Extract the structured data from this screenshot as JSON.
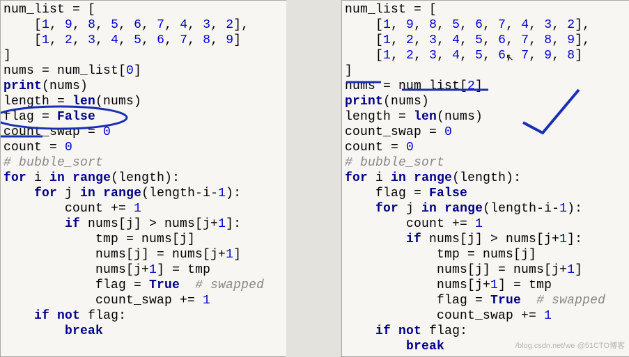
{
  "left": {
    "lines": [
      [
        [
          "num_list ",
          "id"
        ],
        [
          "= [",
          "id"
        ]
      ],
      [
        [
          "    [",
          "id"
        ],
        [
          "1",
          "num"
        ],
        [
          ", ",
          "id"
        ],
        [
          "9",
          "num"
        ],
        [
          ", ",
          "id"
        ],
        [
          "8",
          "num"
        ],
        [
          ", ",
          "id"
        ],
        [
          "5",
          "num"
        ],
        [
          ", ",
          "id"
        ],
        [
          "6",
          "num"
        ],
        [
          ", ",
          "id"
        ],
        [
          "7",
          "num"
        ],
        [
          ", ",
          "id"
        ],
        [
          "4",
          "num"
        ],
        [
          ", ",
          "id"
        ],
        [
          "3",
          "num"
        ],
        [
          ", ",
          "id"
        ],
        [
          "2",
          "num"
        ],
        [
          "],",
          "id"
        ]
      ],
      [
        [
          "    [",
          "id"
        ],
        [
          "1",
          "num"
        ],
        [
          ", ",
          "id"
        ],
        [
          "2",
          "num"
        ],
        [
          ", ",
          "id"
        ],
        [
          "3",
          "num"
        ],
        [
          ", ",
          "id"
        ],
        [
          "4",
          "num"
        ],
        [
          ", ",
          "id"
        ],
        [
          "5",
          "num"
        ],
        [
          ", ",
          "id"
        ],
        [
          "6",
          "num"
        ],
        [
          ", ",
          "id"
        ],
        [
          "7",
          "num"
        ],
        [
          ", ",
          "id"
        ],
        [
          "8",
          "num"
        ],
        [
          ", ",
          "id"
        ],
        [
          "9",
          "num"
        ],
        [
          "]",
          "id"
        ]
      ],
      [
        [
          "]",
          "id"
        ]
      ],
      [
        [
          "nums = num_list[",
          "id"
        ],
        [
          "0",
          "num"
        ],
        [
          "]",
          "id"
        ]
      ],
      [
        [
          "print",
          "kw"
        ],
        [
          "(nums)",
          "id"
        ]
      ],
      [
        [
          "length = ",
          "id"
        ],
        [
          "len",
          "kw"
        ],
        [
          "(nums)",
          "id"
        ]
      ],
      [
        [
          "flag = ",
          "id"
        ],
        [
          "False",
          "kw"
        ]
      ],
      [
        [
          "count_swap = ",
          "id"
        ],
        [
          "0",
          "num"
        ]
      ],
      [
        [
          "count = ",
          "id"
        ],
        [
          "0",
          "num"
        ]
      ],
      [
        [
          "# bubble_sort",
          "cmt"
        ]
      ],
      [
        [
          "for",
          "kw"
        ],
        [
          " i ",
          "id"
        ],
        [
          "in",
          "kw"
        ],
        [
          " ",
          "id"
        ],
        [
          "range",
          "kw"
        ],
        [
          "(length):",
          "id"
        ]
      ],
      [
        [
          "    ",
          "id"
        ],
        [
          "for",
          "kw"
        ],
        [
          " j ",
          "id"
        ],
        [
          "in",
          "kw"
        ],
        [
          " ",
          "id"
        ],
        [
          "range",
          "kw"
        ],
        [
          "(length-i-",
          "id"
        ],
        [
          "1",
          "num"
        ],
        [
          "):",
          "id"
        ]
      ],
      [
        [
          "        count += ",
          "id"
        ],
        [
          "1",
          "num"
        ]
      ],
      [
        [
          "        ",
          "id"
        ],
        [
          "if",
          "kw"
        ],
        [
          " nums[j] > nums[j+",
          "id"
        ],
        [
          "1",
          "num"
        ],
        [
          "]:",
          "id"
        ]
      ],
      [
        [
          "            tmp = nums[j]",
          "id"
        ]
      ],
      [
        [
          "            nums[j] = nums[j+",
          "id"
        ],
        [
          "1",
          "num"
        ],
        [
          "]",
          "id"
        ]
      ],
      [
        [
          "            nums[j+",
          "id"
        ],
        [
          "1",
          "num"
        ],
        [
          "] = tmp",
          "id"
        ]
      ],
      [
        [
          "            flag = ",
          "id"
        ],
        [
          "True",
          "kw"
        ],
        [
          "  ",
          "id"
        ],
        [
          "# swapped",
          "cmt"
        ]
      ],
      [
        [
          "            count_swap += ",
          "id"
        ],
        [
          "1",
          "num"
        ]
      ],
      [
        [
          "    ",
          "id"
        ],
        [
          "if",
          "kw"
        ],
        [
          " ",
          "id"
        ],
        [
          "not",
          "kw"
        ],
        [
          " flag:",
          "id"
        ]
      ],
      [
        [
          "        ",
          "id"
        ],
        [
          "break",
          "kw"
        ]
      ]
    ]
  },
  "right": {
    "lines": [
      [
        [
          "num_list ",
          "id"
        ],
        [
          "= [",
          "id"
        ]
      ],
      [
        [
          "    [",
          "id"
        ],
        [
          "1",
          "num"
        ],
        [
          ", ",
          "id"
        ],
        [
          "9",
          "num"
        ],
        [
          ", ",
          "id"
        ],
        [
          "8",
          "num"
        ],
        [
          ", ",
          "id"
        ],
        [
          "5",
          "num"
        ],
        [
          ", ",
          "id"
        ],
        [
          "6",
          "num"
        ],
        [
          ", ",
          "id"
        ],
        [
          "7",
          "num"
        ],
        [
          ", ",
          "id"
        ],
        [
          "4",
          "num"
        ],
        [
          ", ",
          "id"
        ],
        [
          "3",
          "num"
        ],
        [
          ", ",
          "id"
        ],
        [
          "2",
          "num"
        ],
        [
          "],",
          "id"
        ]
      ],
      [
        [
          "    [",
          "id"
        ],
        [
          "1",
          "num"
        ],
        [
          ", ",
          "id"
        ],
        [
          "2",
          "num"
        ],
        [
          ", ",
          "id"
        ],
        [
          "3",
          "num"
        ],
        [
          ", ",
          "id"
        ],
        [
          "4",
          "num"
        ],
        [
          ", ",
          "id"
        ],
        [
          "5",
          "num"
        ],
        [
          ", ",
          "id"
        ],
        [
          "6",
          "num"
        ],
        [
          ", ",
          "id"
        ],
        [
          "7",
          "num"
        ],
        [
          ", ",
          "id"
        ],
        [
          "8",
          "num"
        ],
        [
          ", ",
          "id"
        ],
        [
          "9",
          "num"
        ],
        [
          "],",
          "id"
        ]
      ],
      [
        [
          "    [",
          "id"
        ],
        [
          "1",
          "num"
        ],
        [
          ", ",
          "id"
        ],
        [
          "2",
          "num"
        ],
        [
          ", ",
          "id"
        ],
        [
          "3",
          "num"
        ],
        [
          ", ",
          "id"
        ],
        [
          "4",
          "num"
        ],
        [
          ", ",
          "id"
        ],
        [
          "5",
          "num"
        ],
        [
          ", ",
          "id"
        ],
        [
          "6",
          "num"
        ],
        [
          ", ",
          "id"
        ],
        [
          "7",
          "num"
        ],
        [
          ", ",
          "id"
        ],
        [
          "9",
          "num"
        ],
        [
          ", ",
          "id"
        ],
        [
          "8",
          "num"
        ],
        [
          "]",
          "id"
        ]
      ],
      [
        [
          "]",
          "id"
        ]
      ],
      [
        [
          "nums = num_list[",
          "id"
        ],
        [
          "2",
          "num"
        ],
        [
          "]",
          "id"
        ]
      ],
      [
        [
          "print",
          "kw"
        ],
        [
          "(nums)",
          "id"
        ]
      ],
      [
        [
          "length = ",
          "id"
        ],
        [
          "len",
          "kw"
        ],
        [
          "(nums)",
          "id"
        ]
      ],
      [
        [
          "count_swap = ",
          "id"
        ],
        [
          "0",
          "num"
        ]
      ],
      [
        [
          "count = ",
          "id"
        ],
        [
          "0",
          "num"
        ]
      ],
      [
        [
          "# bubble_sort",
          "cmt"
        ]
      ],
      [
        [
          "for",
          "kw"
        ],
        [
          " i ",
          "id"
        ],
        [
          "in",
          "kw"
        ],
        [
          " ",
          "id"
        ],
        [
          "range",
          "kw"
        ],
        [
          "(length):",
          "id"
        ]
      ],
      [
        [
          "    flag = ",
          "id"
        ],
        [
          "False",
          "kw"
        ]
      ],
      [
        [
          "    ",
          "id"
        ],
        [
          "for",
          "kw"
        ],
        [
          " j ",
          "id"
        ],
        [
          "in",
          "kw"
        ],
        [
          " ",
          "id"
        ],
        [
          "range",
          "kw"
        ],
        [
          "(length-i-",
          "id"
        ],
        [
          "1",
          "num"
        ],
        [
          "):",
          "id"
        ]
      ],
      [
        [
          "        count += ",
          "id"
        ],
        [
          "1",
          "num"
        ]
      ],
      [
        [
          "        ",
          "id"
        ],
        [
          "if",
          "kw"
        ],
        [
          " nums[j] > nums[j+",
          "id"
        ],
        [
          "1",
          "num"
        ],
        [
          "]:",
          "id"
        ]
      ],
      [
        [
          "            tmp = nums[j]",
          "id"
        ]
      ],
      [
        [
          "            nums[j] = nums[j+",
          "id"
        ],
        [
          "1",
          "num"
        ],
        [
          "]",
          "id"
        ]
      ],
      [
        [
          "            nums[j+",
          "id"
        ],
        [
          "1",
          "num"
        ],
        [
          "] = tmp",
          "id"
        ]
      ],
      [
        [
          "            flag = ",
          "id"
        ],
        [
          "True",
          "kw"
        ],
        [
          "  ",
          "id"
        ],
        [
          "# swapped",
          "cmt"
        ]
      ],
      [
        [
          "            count_swap += ",
          "id"
        ],
        [
          "1",
          "num"
        ]
      ],
      [
        [
          "    ",
          "id"
        ],
        [
          "if",
          "kw"
        ],
        [
          " ",
          "id"
        ],
        [
          "not",
          "kw"
        ],
        [
          " flag:",
          "id"
        ]
      ],
      [
        [
          "        ",
          "id"
        ],
        [
          "break",
          "kw"
        ]
      ]
    ]
  },
  "watermark": "/blog.csdn.net/we   @51CTO博客"
}
